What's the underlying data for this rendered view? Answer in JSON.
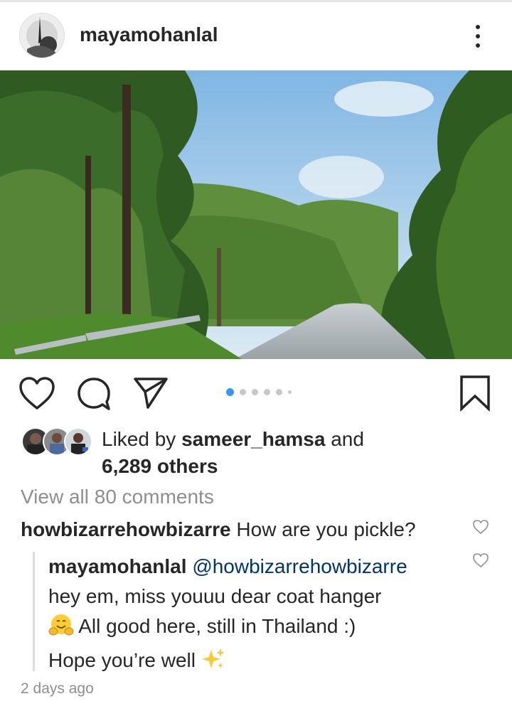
{
  "post": {
    "username": "mayamohanlal"
  },
  "likes": {
    "prefix": "Liked by",
    "user": "sameer_hamsa",
    "connector": "and",
    "others": "6,289 others"
  },
  "comments": {
    "view_all": "View all 80 comments",
    "comment": {
      "user": "howbizarrehowbizarre",
      "text": "How are you pickle?"
    },
    "reply": {
      "user": "mayamohanlal",
      "mention": "@howbizarrehowbizarre",
      "line1": "hey em, miss youuu dear coat hanger",
      "line2": "All good here, still in Thailand :)",
      "line3": "Hope you’re well"
    },
    "timestamp": "2 days ago"
  },
  "carousel": {
    "total_dots": 6,
    "active_index": 0
  },
  "icons": {
    "more": "more-vertical-icon",
    "like": "heart-icon",
    "comment": "comment-bubble-icon",
    "share": "paper-plane-icon",
    "save": "bookmark-icon",
    "hug": "hugging-face-emoji",
    "sparkles": "sparkles-emoji"
  },
  "colors": {
    "text": "#262626",
    "muted": "#8e8e8e",
    "accent": "#3897f0",
    "mention": "#003569"
  }
}
